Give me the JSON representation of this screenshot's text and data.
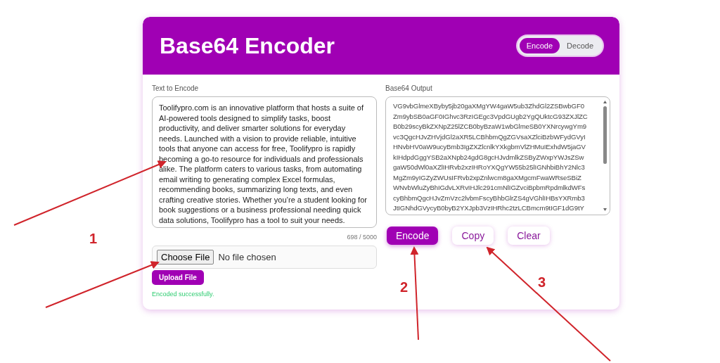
{
  "header": {
    "title": "Base64 Encoder",
    "mode_tabs": [
      {
        "label": "Encode",
        "selected": true
      },
      {
        "label": "Decode",
        "selected": false
      }
    ]
  },
  "input_panel": {
    "label": "Text to Encode",
    "text": "Toolifypro.com is an innovative platform that hosts a suite of AI-powered tools designed to simplify tasks, boost productivity, and deliver smarter solutions for everyday needs. Launched with a vision to provide reliable, intuitive tools that anyone can access for free, Toolifypro is rapidly becoming a go-to resource for individuals and professionals alike. The platform caters to various tasks, from automating email writing to generating complex Excel formulas, recommending books, summarizing long texts, and even crafting creative stories. Whether you’re a student looking for book suggestions or a business professional needing quick data solutions, Toolifypro has a tool to suit your needs.",
    "counter": "698 / 5000",
    "file_button": "Choose File",
    "file_status": "No file chosen",
    "upload_button": "Upload File",
    "status_message": "Encoded successfully."
  },
  "output_panel": {
    "label": "Base64 Output",
    "lines": [
      "VG9vbGlmeXByby5jb20gaXMgYW4gaW5ub3ZhdGl2ZSBwbGF0",
      "Zm9ybSB0aGF0IGhvc3RzIGEgc3VpdGUgb2YgQUktcG93ZXJlZC",
      "B0b29scyBkZXNpZ25lZCB0byBzaW1wbGlmeSB0YXNrcywgYm9",
      "vc3QgcHJvZHVjdGl2aXR5LCBhbmQgZGVsaXZlciBzbWFydGVyI",
      "HNvbHV0aW9ucyBmb3IgZXZlcnlkYXkgbmVlZHMuIExhdW5jaGV",
      "kIHdpdGggYSB2aXNpb24gdG8gcHJvdmlkZSByZWxpYWJsZSw",
      "gaW50dWl0aXZlIHRvb2xzIHRoYXQgYW55b25lIGNhbiBhY2Nlc3",
      "MgZm9yIGZyZWUsIFRvb2xpZnlwcm8gaXMgcmFwaWRseSBiZ",
      "WNvbWluZyBhIGdvLXRvIHJlc291cmNlIGZvciBpbmRpdmlkdWFs",
      "cyBhbmQgcHJvZmVzc2lvbmFscyBhbGlrZS4gVGhlIHBsYXRmb3",
      "JtIGNhdGVycyB0byB2YXJpb3VzIHRhc2tzLCBmcm9tIGF1dG9tY"
    ]
  },
  "actions": [
    {
      "label": "Encode",
      "kind": "primary"
    },
    {
      "label": "Copy",
      "kind": "secondary"
    },
    {
      "label": "Clear",
      "kind": "secondary"
    }
  ],
  "annotations": [
    {
      "label": "1"
    },
    {
      "label": "2"
    },
    {
      "label": "3"
    }
  ]
}
